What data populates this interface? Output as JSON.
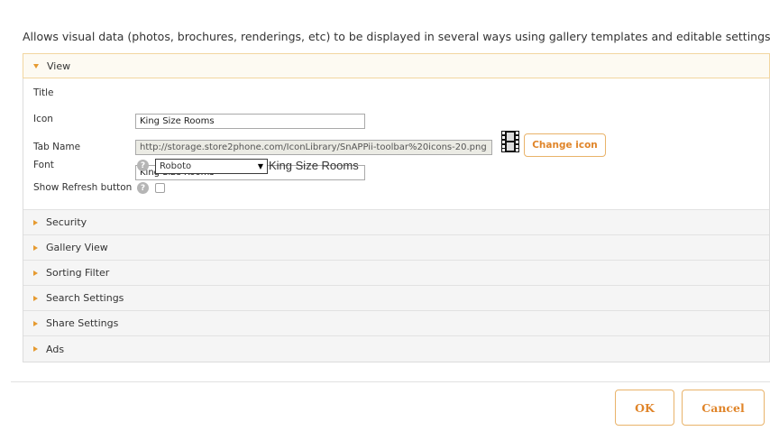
{
  "description": "Allows visual data (photos, brochures, renderings, etc) to be displayed in several ways using gallery templates and editable settings.",
  "view_section": {
    "label": "View",
    "fields": {
      "title_label": "Title",
      "title_value": "King Size Rooms",
      "icon_label": "Icon",
      "icon_url": "http://storage.store2phone.com/IconLibrary/SnAPPii-toolbar%20icons-20.png",
      "change_icon_label": "Change icon",
      "tab_name_label": "Tab Name",
      "tab_name_value": "King Size Rooms",
      "font_label": "Font",
      "font_value": "Roboto",
      "font_preview": "King Size Rooms",
      "refresh_label": "Show Refresh button",
      "refresh_checked": false
    }
  },
  "sections": [
    {
      "label": "Security"
    },
    {
      "label": "Gallery View"
    },
    {
      "label": "Sorting Filter"
    },
    {
      "label": "Search Settings"
    },
    {
      "label": "Share Settings"
    },
    {
      "label": "Ads"
    }
  ],
  "buttons": {
    "ok": "OK",
    "cancel": "Cancel"
  },
  "colors": {
    "accent": "#e0852a",
    "accent_border": "#e9b36a",
    "arrow": "#e69a30"
  },
  "icons": {
    "help": "?",
    "help_icon": "question-circle-icon",
    "film_icon": "film-strip-icon"
  }
}
